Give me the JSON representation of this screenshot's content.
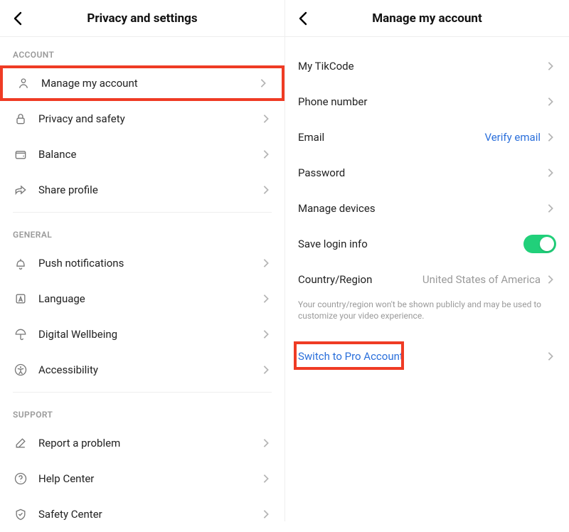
{
  "left": {
    "title": "Privacy and settings",
    "sections": {
      "account": {
        "label": "ACCOUNT",
        "items": {
          "manage": "Manage my account",
          "privacy": "Privacy and safety",
          "balance": "Balance",
          "share": "Share profile"
        }
      },
      "general": {
        "label": "GENERAL",
        "items": {
          "push": "Push notifications",
          "language": "Language",
          "digital": "Digital Wellbeing",
          "accessibility": "Accessibility"
        }
      },
      "support": {
        "label": "SUPPORT",
        "items": {
          "report": "Report a problem",
          "help": "Help Center",
          "safety": "Safety Center"
        }
      }
    }
  },
  "right": {
    "title": "Manage my account",
    "items": {
      "tikcode": {
        "label": "My TikCode"
      },
      "phone": {
        "label": "Phone number"
      },
      "email": {
        "label": "Email",
        "value": "Verify email",
        "value_style": "link"
      },
      "password": {
        "label": "Password"
      },
      "devices": {
        "label": "Manage devices"
      },
      "savelogin": {
        "label": "Save login info",
        "toggle": true
      },
      "country": {
        "label": "Country/Region",
        "value": "United States of America"
      },
      "country_note": "Your country/region won't be shown publicly and may be used to customize your video experience.",
      "switchpro": {
        "label": "Switch to Pro Account"
      }
    }
  }
}
